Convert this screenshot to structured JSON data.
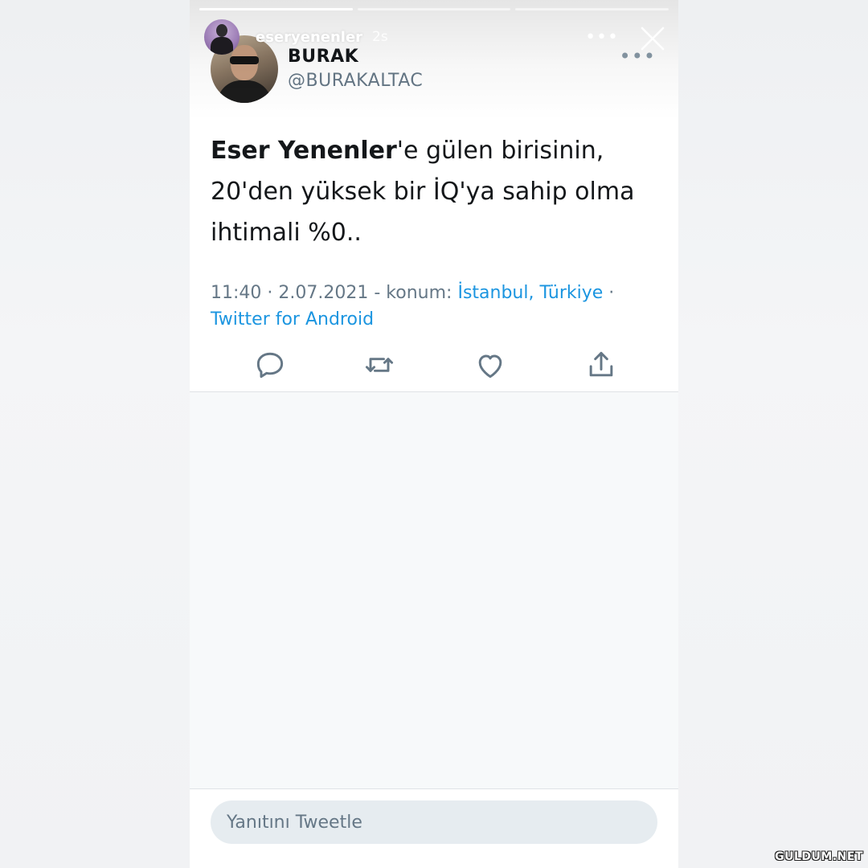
{
  "story": {
    "username": "eseryenenler",
    "time_ago": "2s",
    "progress": [
      1.0,
      0.0,
      0.0
    ],
    "more_icon": "more-horizontal-icon",
    "close_icon": "close-icon"
  },
  "tweet": {
    "author_name": "BURAK",
    "author_handle": "@BURAKALTAC",
    "text_bold": "Eser Yenenler",
    "text_rest": "'e gülen birisinin, 20'den yüksek bir İQ'ya sahip olma ihtimali %0..",
    "time": "11:40",
    "date": "2.07.2021",
    "location_label": "konum:",
    "location": "İstanbul, Türkiye",
    "source": "Twitter for Android",
    "actions": [
      "reply-icon",
      "retweet-icon",
      "like-icon",
      "share-icon"
    ]
  },
  "reply": {
    "placeholder": "Yanıtını Tweetle"
  },
  "watermark": "GULDUM.NET",
  "colors": {
    "link": "#1b95e0",
    "secondary_text": "#657786",
    "primary_text": "#14171a"
  }
}
